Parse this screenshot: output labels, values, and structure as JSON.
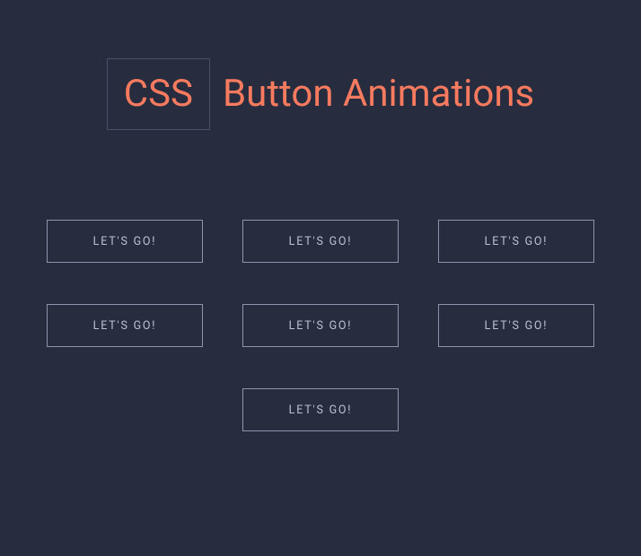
{
  "header": {
    "title_prefix": "CSS",
    "title_rest": "Button Animations"
  },
  "buttons": [
    {
      "label": "LET'S GO!"
    },
    {
      "label": "LET'S GO!"
    },
    {
      "label": "LET'S GO!"
    },
    {
      "label": "LET'S GO!"
    },
    {
      "label": "LET'S GO!"
    },
    {
      "label": "LET'S GO!"
    },
    {
      "label": "LET'S GO!"
    }
  ]
}
